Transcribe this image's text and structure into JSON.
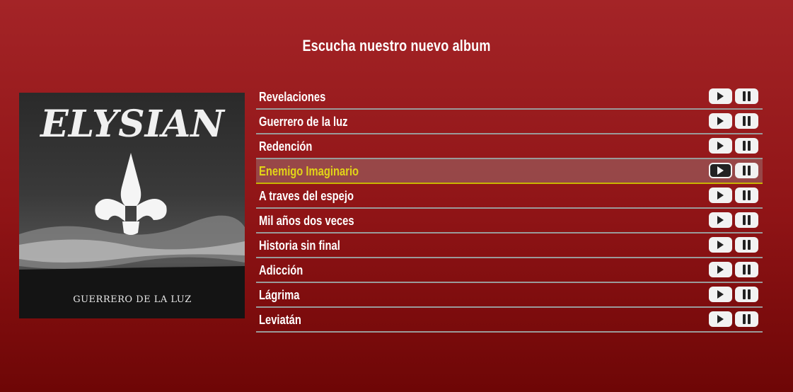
{
  "header": {
    "title": "Escucha nuestro nuevo album"
  },
  "album": {
    "cover_band_text": "ELYSIAN",
    "cover_subtitle": "GUERRERO DE LA LUZ"
  },
  "tracks": [
    {
      "name": "Revelaciones",
      "active": false
    },
    {
      "name": "Guerrero de la luz",
      "active": false
    },
    {
      "name": "Redención",
      "active": false
    },
    {
      "name": "Enemigo Imaginario",
      "active": true
    },
    {
      "name": "A traves del espejo",
      "active": false
    },
    {
      "name": "Mil años dos veces",
      "active": false
    },
    {
      "name": "Historia sin final",
      "active": false
    },
    {
      "name": "Adicción",
      "active": false
    },
    {
      "name": "Lágrima",
      "active": false
    },
    {
      "name": "Leviatán",
      "active": false
    }
  ],
  "icons": {
    "play": "play-icon",
    "pause": "pause-icon"
  },
  "colors": {
    "background_top": "#a42427",
    "background_bottom": "#6e0606",
    "active_text": "#e2d417",
    "active_underline": "#c9b400"
  }
}
